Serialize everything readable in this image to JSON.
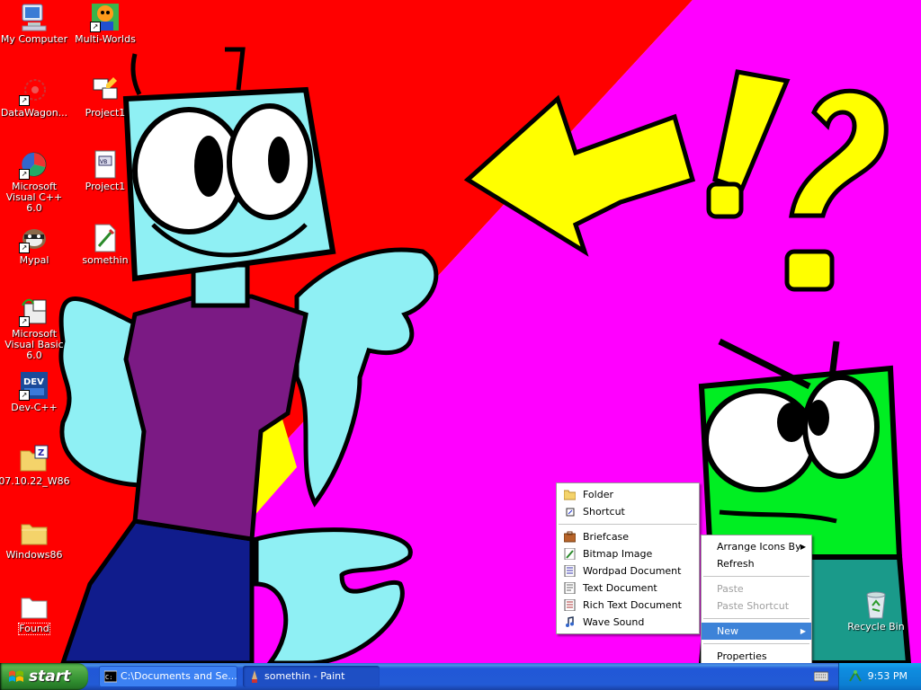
{
  "desktop": {
    "icons": [
      {
        "label": "My Computer"
      },
      {
        "label": "Multi-Worlds"
      },
      {
        "label": "DataWagon..."
      },
      {
        "label": "Project1"
      },
      {
        "label": "Microsoft Visual C++ 6.0"
      },
      {
        "label": "Project1"
      },
      {
        "label": "Mypal"
      },
      {
        "label": "somethin"
      },
      {
        "label": "Microsoft Visual Basic 6.0"
      },
      {
        "label": "Dev-C++"
      },
      {
        "label": "07.10.22_W86"
      },
      {
        "label": "Windows86"
      },
      {
        "label": "Found"
      },
      {
        "label": "Recycle Bin"
      }
    ],
    "wallpaper_text": {
      "q1": "!",
      "q2": "?"
    },
    "colors": {
      "red": "#ff0000",
      "magenta": "#ff00ff",
      "yellow": "#ffff00",
      "cyan": "#8ff0f4",
      "purple": "#7b1a84",
      "navy": "#101c8c",
      "green": "#00ee22"
    }
  },
  "context_menu": {
    "items": [
      {
        "label": "Arrange Icons By",
        "submenu": true
      },
      {
        "label": "Refresh"
      },
      {
        "label": "Paste",
        "disabled": true
      },
      {
        "label": "Paste Shortcut",
        "disabled": true
      },
      {
        "label": "New",
        "submenu": true,
        "highlighted": true
      },
      {
        "label": "Properties"
      }
    ]
  },
  "new_submenu": {
    "items": [
      {
        "label": "Folder",
        "icon": "folder-icon"
      },
      {
        "label": "Shortcut",
        "icon": "shortcut-icon"
      },
      {
        "label": "Briefcase",
        "icon": "briefcase-icon"
      },
      {
        "label": "Bitmap Image",
        "icon": "bitmap-icon"
      },
      {
        "label": "Wordpad Document",
        "icon": "wordpad-icon"
      },
      {
        "label": "Text Document",
        "icon": "text-document-icon"
      },
      {
        "label": "Rich Text Document",
        "icon": "rich-text-icon"
      },
      {
        "label": "Wave Sound",
        "icon": "wave-sound-icon"
      }
    ]
  },
  "taskbar": {
    "start_label": "start",
    "tasks": [
      {
        "label": "C:\\Documents and Se..."
      },
      {
        "label": "somethin - Paint"
      }
    ],
    "clock": "9:53 PM"
  }
}
